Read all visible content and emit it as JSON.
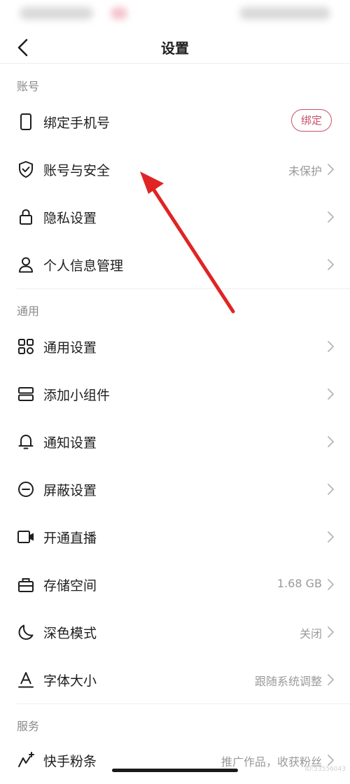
{
  "header": {
    "title": "设置"
  },
  "sections": [
    {
      "title": "账号"
    },
    {
      "title": "通用"
    },
    {
      "title": "服务"
    }
  ],
  "rows": [
    {
      "label": "绑定手机号",
      "icon": "phone-icon",
      "button": "绑定"
    },
    {
      "label": "账号与安全",
      "icon": "shield-check-icon",
      "value": "未保护"
    },
    {
      "label": "隐私设置",
      "icon": "lock-icon"
    },
    {
      "label": "个人信息管理",
      "icon": "person-icon"
    },
    {
      "label": "通用设置",
      "icon": "grid-icon"
    },
    {
      "label": "添加小组件",
      "icon": "widget-icon"
    },
    {
      "label": "通知设置",
      "icon": "bell-icon"
    },
    {
      "label": "屏蔽设置",
      "icon": "block-icon"
    },
    {
      "label": "开通直播",
      "icon": "video-camera-icon"
    },
    {
      "label": "存储空间",
      "icon": "storage-icon",
      "value": "1.68 GB"
    },
    {
      "label": "深色模式",
      "icon": "moon-icon",
      "value": "关闭"
    },
    {
      "label": "字体大小",
      "icon": "font-size-icon",
      "value": "跟随系统调整"
    },
    {
      "label": "快手粉条",
      "icon": "promote-icon",
      "value": "推广作品，收获粉丝"
    }
  ],
  "watermark": "ID:53556043",
  "colors": {
    "accent": "#c8506a",
    "arrow": "#e02424"
  }
}
